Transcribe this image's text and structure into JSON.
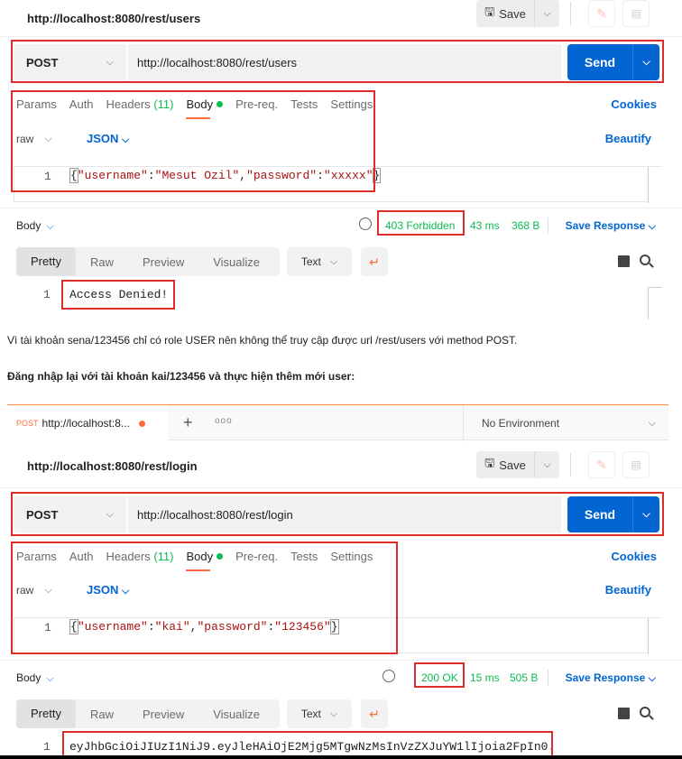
{
  "panel1": {
    "title_url": "http://localhost:8080/rest/users",
    "save_label": "Save",
    "method": "POST",
    "url": "http://localhost:8080/rest/users",
    "send_label": "Send",
    "tabs": [
      "Params",
      "Auth",
      "Headers",
      "(11)",
      "Body",
      "Pre-req.",
      "Tests",
      "Settings"
    ],
    "cookies_label": "Cookies",
    "body_type": "raw",
    "body_format": "JSON",
    "beautify_label": "Beautify",
    "line_no": "1",
    "body_code": {
      "open": "{",
      "k1": "\"username\"",
      "c1": ":",
      "v1": "\"Mesut Ozil\"",
      "comma": ",",
      "k2": "\"password\"",
      "c2": ":",
      "v2": "\"xxxxx\"",
      "close": "}"
    },
    "response_label": "Body",
    "status": "403 Forbidden",
    "time": "43 ms",
    "size": "368 B",
    "save_response": "Save Response",
    "view_tabs": [
      "Pretty",
      "Raw",
      "Preview",
      "Visualize"
    ],
    "text_format": "Text",
    "response_line": "1",
    "response_text": "Access Denied!"
  },
  "paragraph1": "Vì tài khoản sena/123456 chỉ có role USER nên không thể truy cập được url /rest/users với method POST.",
  "paragraph2": "Đăng nhập lại với tài khoản kai/123456 và thực hiện thêm mới user:",
  "tabstrip": {
    "tab_method": "POST",
    "tab_url": "http://localhost:8...",
    "plus": "+",
    "more": "ooo",
    "environment": "No Environment"
  },
  "panel2": {
    "title_url": "http://localhost:8080/rest/login",
    "save_label": "Save",
    "method": "POST",
    "url": "http://localhost:8080/rest/login",
    "send_label": "Send",
    "tabs": [
      "Params",
      "Auth",
      "Headers",
      "(11)",
      "Body",
      "Pre-req.",
      "Tests",
      "Settings"
    ],
    "cookies_label": "Cookies",
    "body_type": "raw",
    "body_format": "JSON",
    "beautify_label": "Beautify",
    "line_no": "1",
    "body_code": {
      "open": "{",
      "k1": "\"username\"",
      "c1": ":",
      "v1": "\"kai\"",
      "comma": ",",
      "k2": "\"password\"",
      "c2": ":",
      "v2": "\"123456\"",
      "close": "}"
    },
    "response_label": "Body",
    "status": "200 OK",
    "time": "15 ms",
    "size": "505 B",
    "save_response": "Save Response",
    "view_tabs": [
      "Pretty",
      "Raw",
      "Preview",
      "Visualize"
    ],
    "text_format": "Text",
    "response_line": "1",
    "response_text": "eyJhbGciOiJIUzI1NiJ9.eyJleHAiOjE2Mjg5MTgwNzMsInVzZXJuYW1lIjoia2FpIn0."
  },
  "colors": {
    "accent": "#ff6c37",
    "send": "#0265d2",
    "status_ok": "#0cbb52",
    "highlight": "#e02b2b"
  }
}
